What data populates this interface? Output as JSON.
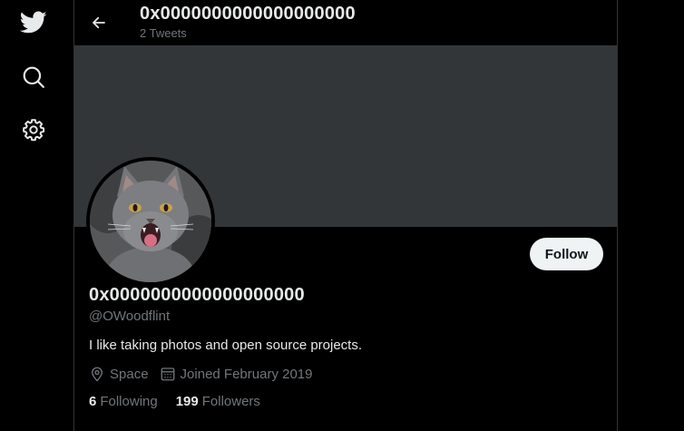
{
  "nav": {
    "items": [
      {
        "icon": "twitter-bird-icon"
      },
      {
        "icon": "search-icon"
      },
      {
        "icon": "gear-icon"
      }
    ]
  },
  "header": {
    "title": "0x0000000000000000000",
    "tweet_count": "2 Tweets"
  },
  "profile": {
    "display_name": "0x0000000000000000000",
    "handle": "@OWoodflint",
    "bio": "I like taking photos and open source projects.",
    "location": "Space",
    "joined": "Joined February 2019",
    "follow_label": "Follow",
    "following_count": "6",
    "following_label": "Following",
    "followers_count": "199",
    "followers_label": "Followers"
  },
  "colors": {
    "background": "#000000",
    "banner": "#333639",
    "text_primary": "#e7e9ea",
    "text_secondary": "#71767b",
    "follow_button_bg": "#eff3f4"
  }
}
